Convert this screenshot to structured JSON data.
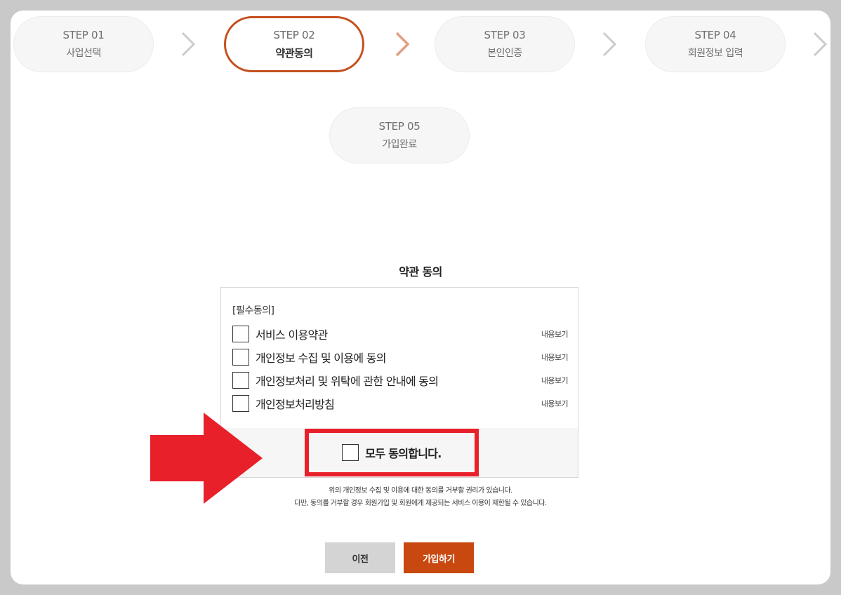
{
  "steps": [
    {
      "num": "STEP 01",
      "name": "사업선택",
      "active": false
    },
    {
      "num": "STEP 02",
      "name": "약관동의",
      "active": true
    },
    {
      "num": "STEP 03",
      "name": "본인인증",
      "active": false
    },
    {
      "num": "STEP 04",
      "name": "회원정보 입력",
      "active": false
    },
    {
      "num": "STEP 05",
      "name": "가입완료",
      "active": false
    }
  ],
  "colors": {
    "accent": "#c5501e",
    "join_button": "#c8480f",
    "highlight_red": "#e8202a",
    "prev_button": "#d3d4d3",
    "chevron_active": "#e0a083",
    "chevron": "#cccccc"
  },
  "terms": {
    "title": "약관 동의",
    "required_label": "[필수동의]",
    "items": [
      {
        "label": "서비스 이용약관",
        "view": "내용보기",
        "checked": false
      },
      {
        "label": "개인정보 수집 및 이용에 동의",
        "view": "내용보기",
        "checked": false
      },
      {
        "label": "개인정보처리 및 위탁에 관한 안내에 동의",
        "view": "내용보기",
        "checked": false
      },
      {
        "label": "개인정보처리방침",
        "view": "내용보기",
        "checked": false
      }
    ],
    "agree_all_label": "모두 동의합니다.",
    "agree_all_checked": false
  },
  "notice": {
    "line1": "위의 개인정보 수집 및 이용에 대한 동의를 거부할 권리가 있습니다.",
    "line2": "다만, 동의를 거부할 경우 회원가입 및 회원에게 제공되는 서비스 이용이 제한될 수 있습니다."
  },
  "buttons": {
    "prev": "이전",
    "join": "가입하기"
  }
}
